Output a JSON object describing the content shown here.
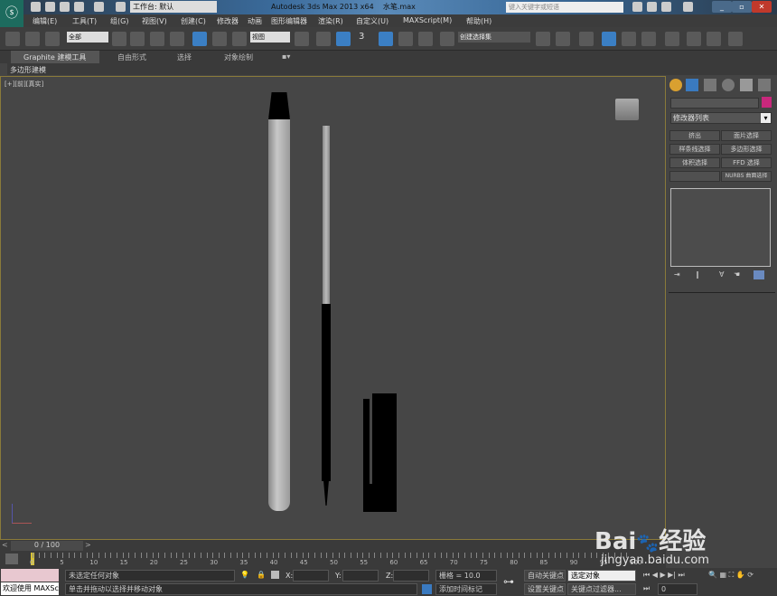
{
  "title": {
    "workspace": "工作台: 默认",
    "app": "Autodesk 3ds Max  2013 x64",
    "file": "水笔.max",
    "search_placeholder": "键入关键字或短语"
  },
  "menu": [
    "编辑(E)",
    "工具(T)",
    "组(G)",
    "视图(V)",
    "创建(C)",
    "修改器",
    "动画",
    "图形编辑器",
    "渲染(R)",
    "自定义(U)",
    "MAXScript(M)",
    "帮助(H)"
  ],
  "toolbar": {
    "selection_filter": "全部",
    "reference_coord": "视图",
    "named_selection": "创建选择集",
    "snap_label": "3"
  },
  "ribbon": {
    "tabs": [
      "Graphite 建模工具",
      "自由形式",
      "选择",
      "对象绘制"
    ],
    "sub_tab": "多边形建模"
  },
  "viewport": {
    "label": "[+][前][真实]"
  },
  "command_panel": {
    "modifier_list": "修改器列表",
    "color": "#c8287c",
    "buttons": [
      "挤出",
      "面片选择",
      "样条线选择",
      "多边形选择",
      "体积选择",
      "FFD 选择",
      "",
      "NURBS 曲面选择"
    ]
  },
  "timeline": {
    "frame": "0 / 100",
    "ticks": [
      "0",
      "5",
      "10",
      "15",
      "20",
      "25",
      "30",
      "35",
      "40",
      "45",
      "50",
      "55",
      "60",
      "65",
      "70",
      "75",
      "80",
      "85",
      "90",
      "95",
      "100"
    ]
  },
  "status": {
    "welcome": "欢迎使用 MAXSc",
    "selection": "未选定任何对象",
    "prompt": "单击并拖动以选择并移动对象",
    "x_label": "X:",
    "y_label": "Y:",
    "z_label": "Z:",
    "grid": "栅格 = 10.0",
    "add_time_tag": "添加时间标记",
    "auto_key": "自动关键点",
    "set_key": "设置关键点",
    "key_mode": "选定对象",
    "key_filters": "关键点过滤器...",
    "current_frame": "0"
  },
  "watermark": {
    "brand": "Bai du 经验",
    "url": "jingyan.baidu.com"
  }
}
